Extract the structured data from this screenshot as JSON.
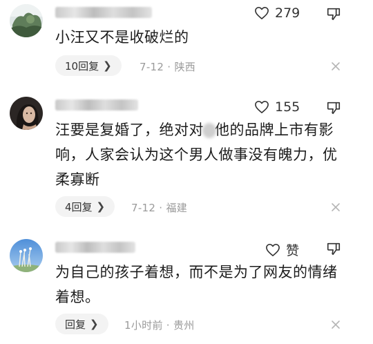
{
  "comments": [
    {
      "like_count": "279",
      "text": "小汪又不是收破烂的",
      "reply_label": "10回复",
      "meta": "7-12 · 陕西"
    },
    {
      "like_count": "155",
      "text_part1": "汪要是复婚了，绝对对",
      "text_part2": "他的品牌上市有影响，人家会认为这个男人做事没有魄力，优柔寡断",
      "reply_label": "4回复",
      "meta": "7-12 · 福建"
    },
    {
      "like_label": "赞",
      "text": "为自己的孩子着想，而不是为了网友的情绪着想。",
      "reply_label": "回复",
      "meta": "1小时前 · 贵州"
    }
  ],
  "icons": {
    "like": "heart-outline-icon",
    "dislike": "thumbs-down-outline-icon",
    "close": "close-icon",
    "chevron": "chevron-right-icon"
  }
}
